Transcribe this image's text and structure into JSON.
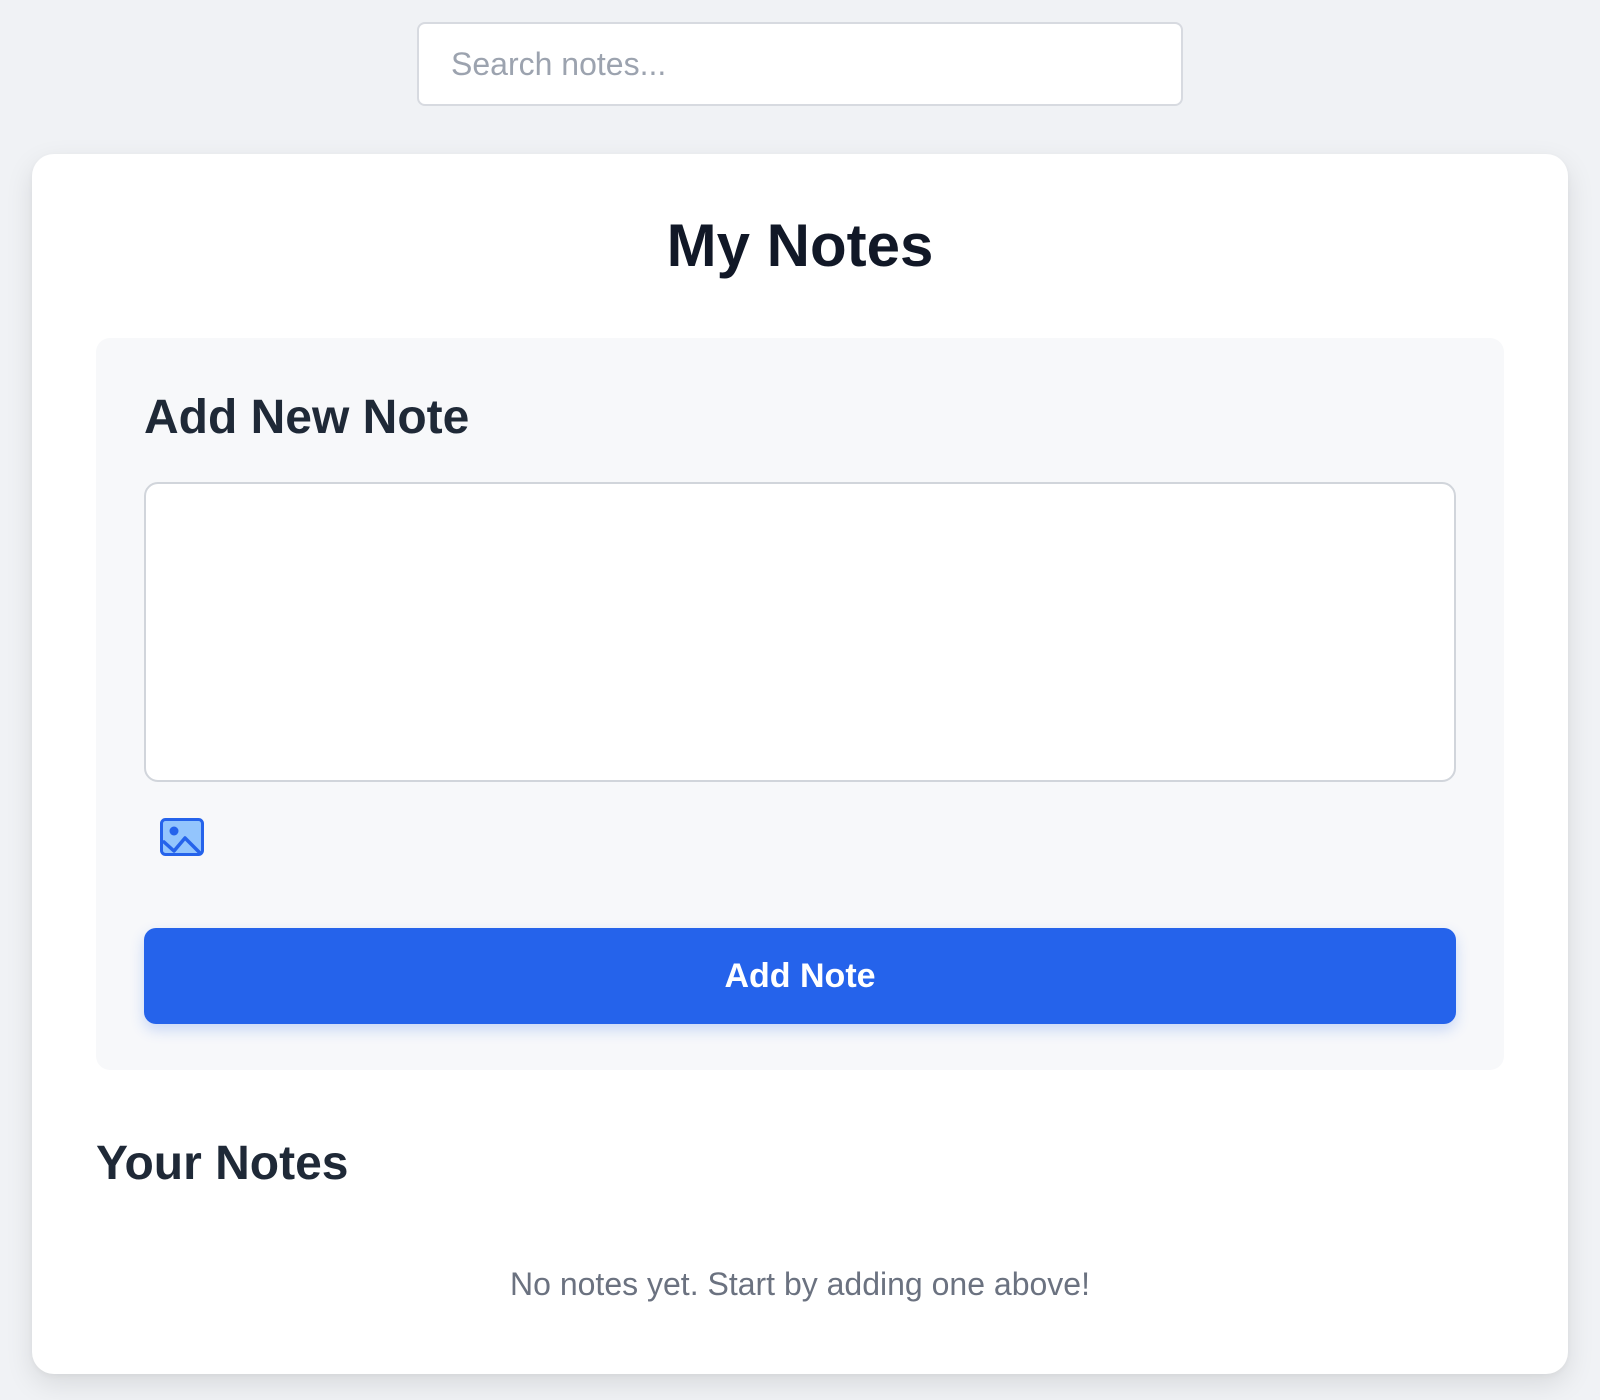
{
  "search": {
    "placeholder": "Search notes...",
    "value": ""
  },
  "header": {
    "title": "My Notes"
  },
  "add_note": {
    "title": "Add New Note",
    "textarea_value": "",
    "image_icon": "image-icon",
    "button_label": "Add Note"
  },
  "notes": {
    "title": "Your Notes",
    "empty_message": "No notes yet. Start by adding one above!",
    "items": []
  },
  "colors": {
    "accent": "#2563eb",
    "background": "#f0f2f5",
    "card": "#ffffff",
    "panel": "#f7f8fa",
    "heading": "#111827",
    "muted_text": "#6b7280"
  }
}
